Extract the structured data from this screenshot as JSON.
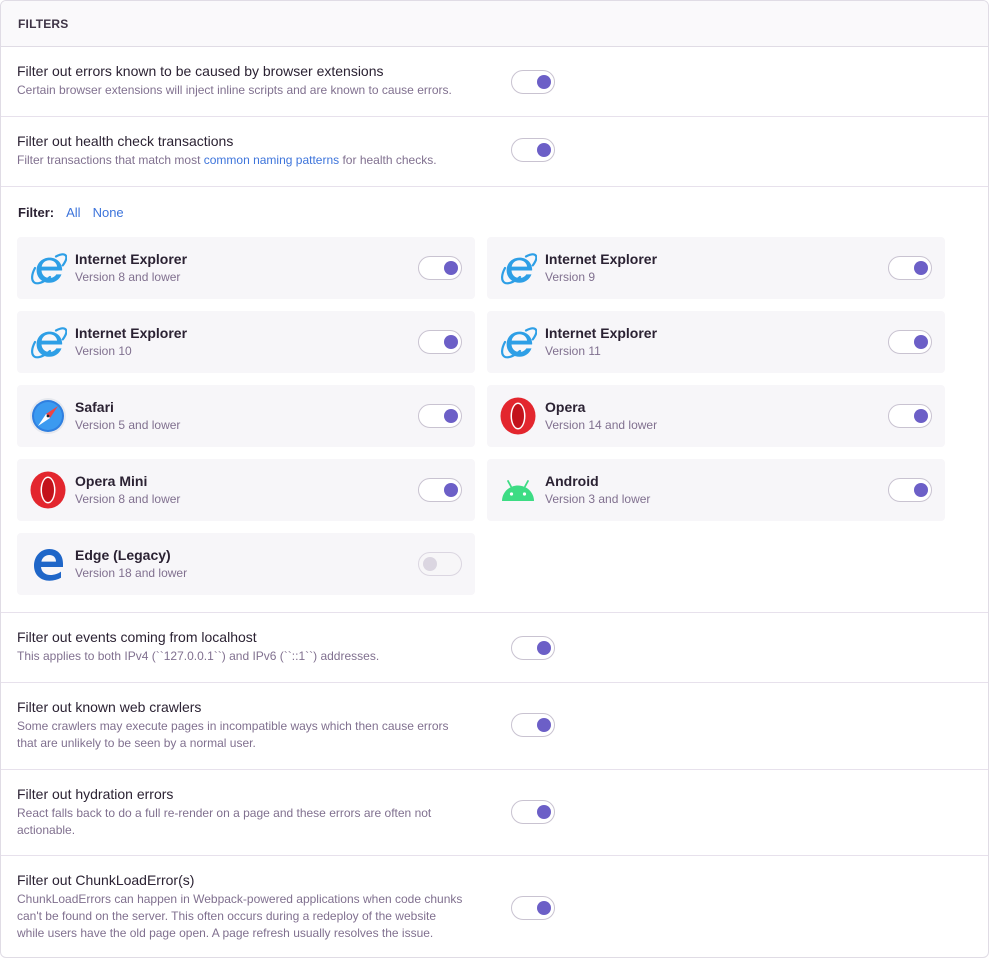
{
  "header": {
    "title": "FILTERS"
  },
  "filters": [
    {
      "title": "Filter out errors known to be caused by browser extensions",
      "help": "Certain browser extensions will inject inline scripts and are known to cause errors.",
      "enabled": true
    },
    {
      "title": "Filter out health check transactions",
      "help_before": "Filter transactions that match most ",
      "help_link": "common naming patterns",
      "help_after": " for health checks.",
      "enabled": true
    },
    {
      "title": "Filter out events coming from localhost",
      "help": "This applies to both IPv4 (``127.0.0.1``) and IPv6 (``::1``) addresses.",
      "enabled": true
    },
    {
      "title": "Filter out known web crawlers",
      "help_line1": "Some crawlers may execute pages in incompatible ways which then cause errors",
      "help_line2": "that are unlikely to be seen by a normal user.",
      "enabled": true
    },
    {
      "title": "Filter out hydration errors",
      "help_line1": "React falls back to do a full re-render on a page and these errors are often not",
      "help_line2": "actionable.",
      "enabled": true
    },
    {
      "title": "Filter out ChunkLoadError(s)",
      "help_line1": "ChunkLoadErrors can happen in Webpack-powered applications when code chunks",
      "help_line2": "can't be found on the server. This often occurs during a redeploy of the website",
      "help_line3": "while users have the old page open. A page refresh usually resolves the issue.",
      "enabled": true
    }
  ],
  "legacy_browsers": {
    "filter_label": "Filter:",
    "all_label": "All",
    "none_label": "None",
    "items": [
      {
        "name": "Internet Explorer",
        "version": "Version 8 and lower",
        "icon": "internet-explorer-icon",
        "enabled": true
      },
      {
        "name": "Internet Explorer",
        "version": "Version 9",
        "icon": "internet-explorer-icon",
        "enabled": true
      },
      {
        "name": "Internet Explorer",
        "version": "Version 10",
        "icon": "internet-explorer-icon",
        "enabled": true
      },
      {
        "name": "Internet Explorer",
        "version": "Version 11",
        "icon": "internet-explorer-icon",
        "enabled": true
      },
      {
        "name": "Safari",
        "version": "Version 5 and lower",
        "icon": "safari-icon",
        "enabled": true
      },
      {
        "name": "Opera",
        "version": "Version 14 and lower",
        "icon": "opera-icon",
        "enabled": true
      },
      {
        "name": "Opera Mini",
        "version": "Version 8 and lower",
        "icon": "opera-icon",
        "enabled": true
      },
      {
        "name": "Android",
        "version": "Version 3 and lower",
        "icon": "android-icon",
        "enabled": true
      },
      {
        "name": "Edge (Legacy)",
        "version": "Version 18 and lower",
        "icon": "edge-legacy-icon",
        "enabled": false
      }
    ]
  },
  "colors": {
    "accent": "#6c5fc7",
    "link": "#3d74db",
    "muted_text": "#80708f"
  }
}
